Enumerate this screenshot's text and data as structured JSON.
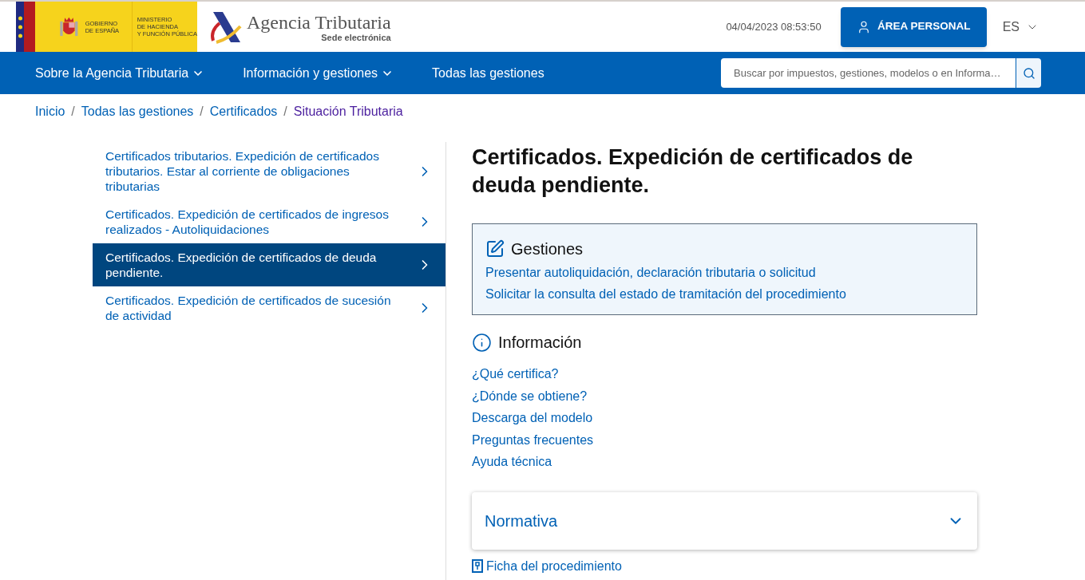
{
  "header": {
    "gov_name": "GOBIERNO DE ESPAÑA",
    "ministry_lines": [
      "MINISTERIO",
      "DE HACIENDA",
      "Y FUNCIÓN PÚBLICA"
    ],
    "agency_name": "Agencia Tributaria",
    "agency_subtitle": "Sede electrónica",
    "datetime": "04/04/2023 08:53:50",
    "personal_button": "ÁREA PERSONAL",
    "language": "ES"
  },
  "nav": {
    "items": [
      {
        "label": "Sobre la Agencia Tributaria",
        "dropdown": true
      },
      {
        "label": "Información y gestiones",
        "dropdown": true
      },
      {
        "label": "Todas las gestiones",
        "dropdown": false
      }
    ],
    "search": {
      "placeholder": "Buscar por impuestos, gestiones, modelos o en Informa…"
    }
  },
  "breadcrumb_separator": "/",
  "breadcrumb": [
    {
      "label": "Inicio",
      "current": false
    },
    {
      "label": "Todas las gestiones",
      "current": false
    },
    {
      "label": "Certificados",
      "current": false
    },
    {
      "label": "Situación Tributaria",
      "current": true
    }
  ],
  "sidebar": {
    "items": [
      {
        "label": "Certificados tributarios. Expedición de certificados tributarios. Estar al corriente de obligaciones tributarias",
        "selected": false
      },
      {
        "label": "Certificados. Expedición de certificados de ingresos realizados - Autoliquidaciones",
        "selected": false
      },
      {
        "label": "Certificados. Expedición de certificados de deuda pendiente.",
        "selected": true
      },
      {
        "label": "Certificados. Expedición de certificados de sucesión de actividad",
        "selected": false
      }
    ]
  },
  "page_title": "Certificados. Expedición de certificados de deuda pendiente.",
  "gestiones": {
    "title": "Gestiones",
    "links": [
      "Presentar autoliquidación, declaración tributaria o solicitud",
      "Solicitar la consulta del estado de tramitación del procedimiento"
    ]
  },
  "informacion": {
    "title": "Información",
    "links": [
      "¿Qué certifica?",
      "¿Dónde se obtiene?",
      "Descarga del modelo",
      "Preguntas frecuentes",
      "Ayuda técnica"
    ]
  },
  "normativa": {
    "title": "Normativa",
    "expanded": false
  },
  "ficha_link": "Ficha del procedimiento"
}
